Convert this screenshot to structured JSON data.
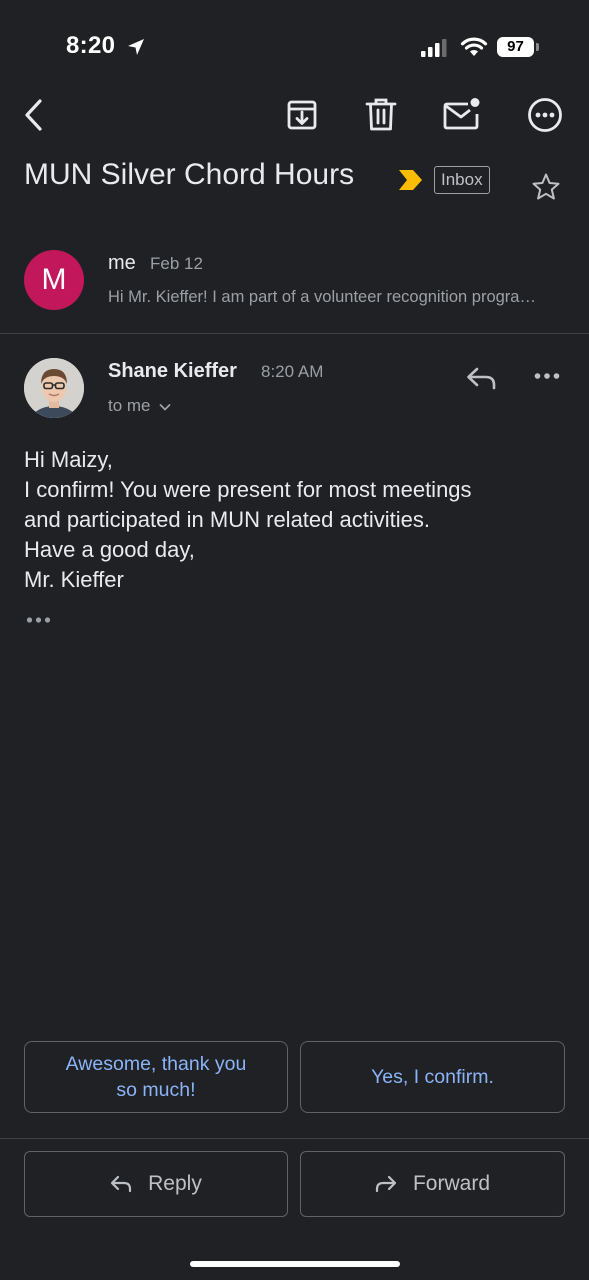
{
  "status_bar": {
    "time": "8:20",
    "battery": "97"
  },
  "toolbar": {
    "icons": [
      "back-icon",
      "archive-icon",
      "trash-icon",
      "mark-unread-icon",
      "more-icon"
    ]
  },
  "thread": {
    "subject": "MUN Silver Chord Hours",
    "label": "Inbox",
    "important_color": "#fbbc04"
  },
  "messages": [
    {
      "avatar_letter": "M",
      "avatar_color": "#c2185b",
      "sender": "me",
      "date": "Feb 12",
      "snippet": "Hi Mr. Kieffer! I am part of a volunteer recognition program and need to confirm my hours"
    },
    {
      "sender": "Shane Kieffer",
      "time": "8:20 AM",
      "recipient": "to me",
      "body": [
        "Hi Maizy,",
        "I confirm!  You were present for most meetings",
        "and participated in MUN related activities.",
        "Have a good day,",
        "Mr. Kieffer"
      ]
    }
  ],
  "smart_replies": {
    "first": [
      "Awesome, thank you",
      "so much!"
    ],
    "second": "Yes, I confirm."
  },
  "actions": {
    "reply": "Reply",
    "forward": "Forward"
  },
  "colors": {
    "background": "#202124",
    "accent": "#8ab4f8",
    "text": "#e8eaed",
    "muted": "#9aa0a6"
  }
}
